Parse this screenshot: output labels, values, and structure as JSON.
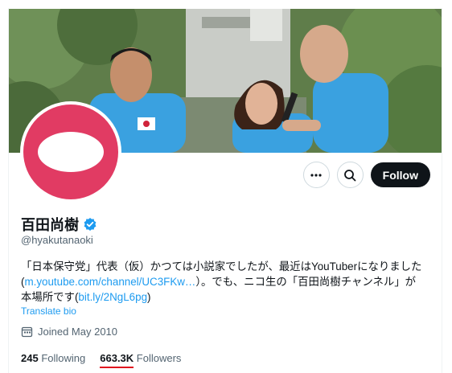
{
  "profile": {
    "display_name": "百田尚樹",
    "handle": "@hyakutanaoki",
    "bio_line1": "「日本保守党」代表（仮）かつては小説家でしたが、最近はYouTuberになりました",
    "bio_link1": "m.youtube.com/channel/UC3FKw…",
    "bio_mid": "）。でも、ニコ生の「百田尚樹チャンネル」が",
    "bio_pre_link2": "本場所です(",
    "bio_link2": "bit.ly/2NgL6pg",
    "bio_post_link2": ")",
    "bio_prefix": "(",
    "translate_label": "Translate bio",
    "joined": "Joined May 2010"
  },
  "stats": {
    "following_count": "245",
    "following_label": "Following",
    "followers_count": "663.3K",
    "followers_label": "Followers"
  },
  "actions": {
    "more_icon": "more-icon",
    "search_icon": "search-icon",
    "follow_label": "Follow"
  },
  "colors": {
    "avatar_bg": "#e13b63",
    "link": "#1d9bf0",
    "verified": "#1d9bf0",
    "follow_bg": "#0f1419",
    "underline": "#e0141e"
  }
}
